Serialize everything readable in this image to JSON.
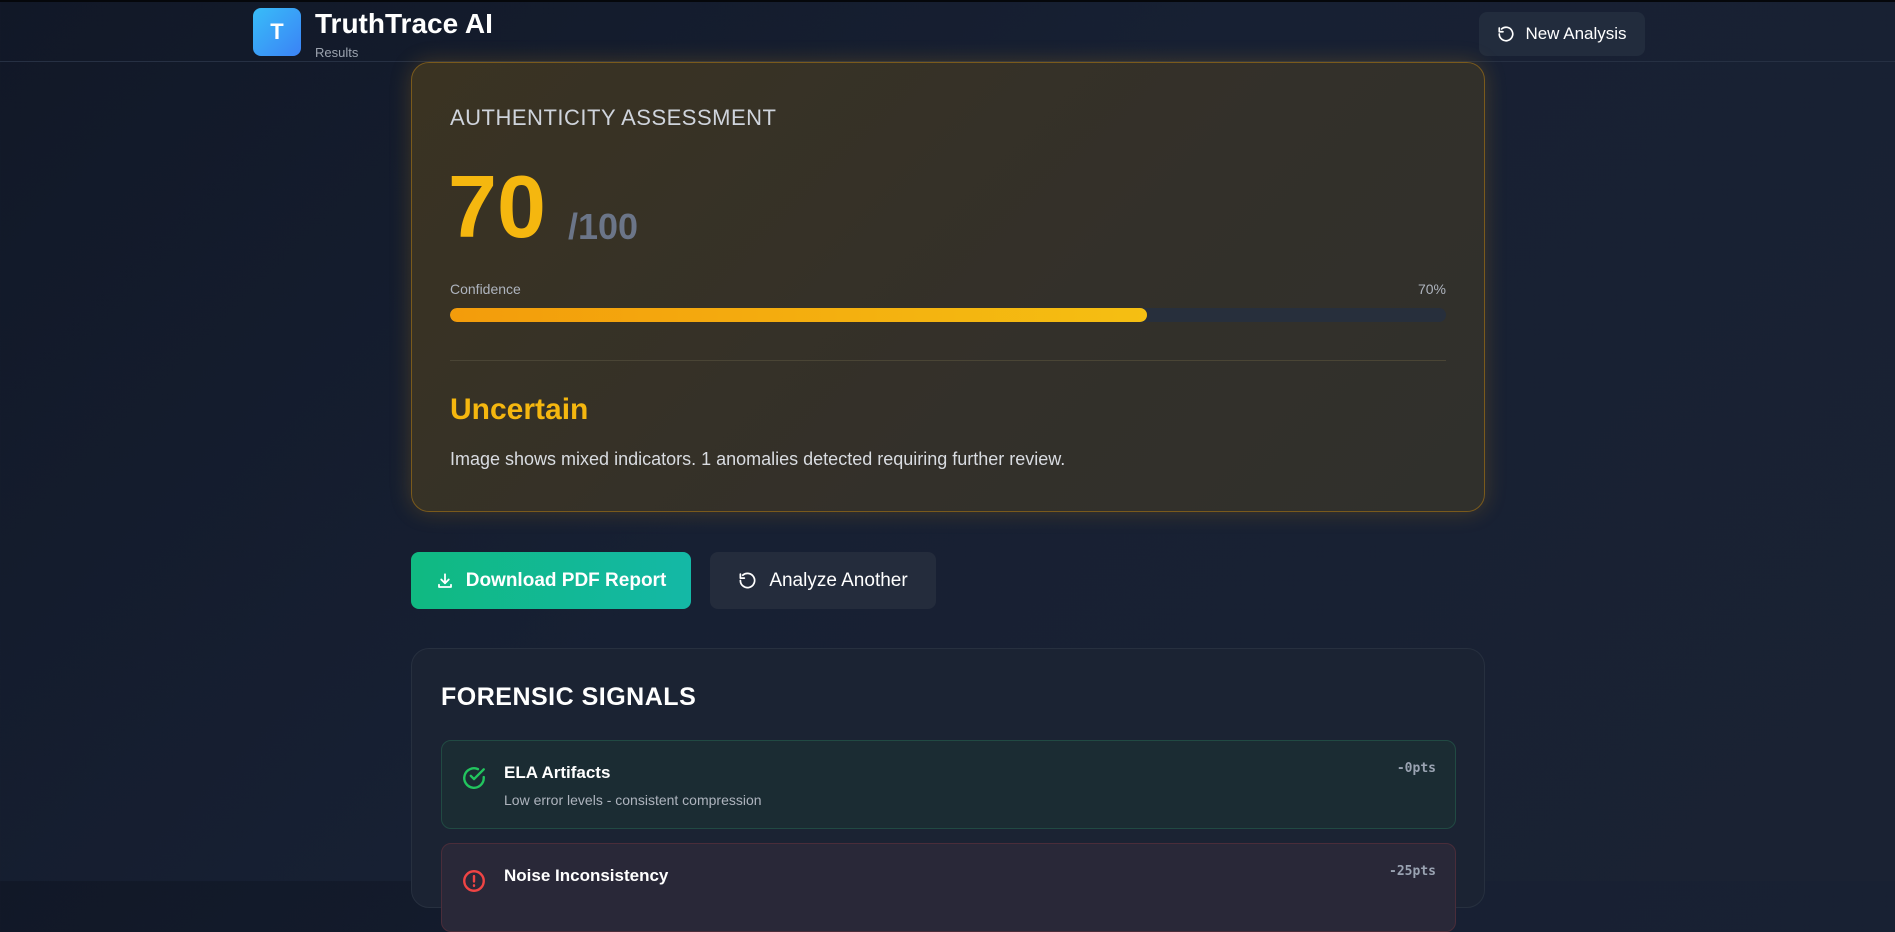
{
  "header": {
    "logo_letter": "T",
    "title": "TruthTrace AI",
    "subtitle": "Results",
    "new_analysis_label": "New Analysis"
  },
  "assessment": {
    "heading": "AUTHENTICITY ASSESSMENT",
    "score": "70",
    "score_max": "/100",
    "confidence_label": "Confidence",
    "confidence_text": "70%",
    "confidence_value": 70,
    "verdict": "Uncertain",
    "description": "Image shows mixed indicators. 1 anomalies detected requiring further review.",
    "accent_color": "#f5b70f"
  },
  "actions": {
    "download_label": "Download PDF Report",
    "analyze_another_label": "Analyze Another"
  },
  "signals": {
    "title": "FORENSIC SIGNALS",
    "items": [
      {
        "name": "ELA Artifacts",
        "description": "Low error levels - consistent compression",
        "points": "-0pts",
        "status": "pass",
        "icon": "check-circle-icon",
        "color": "#22c55e"
      },
      {
        "name": "Noise Inconsistency",
        "description": "",
        "points": "-25pts",
        "status": "fail",
        "icon": "alert-circle-icon",
        "color": "#ef4444"
      }
    ]
  }
}
